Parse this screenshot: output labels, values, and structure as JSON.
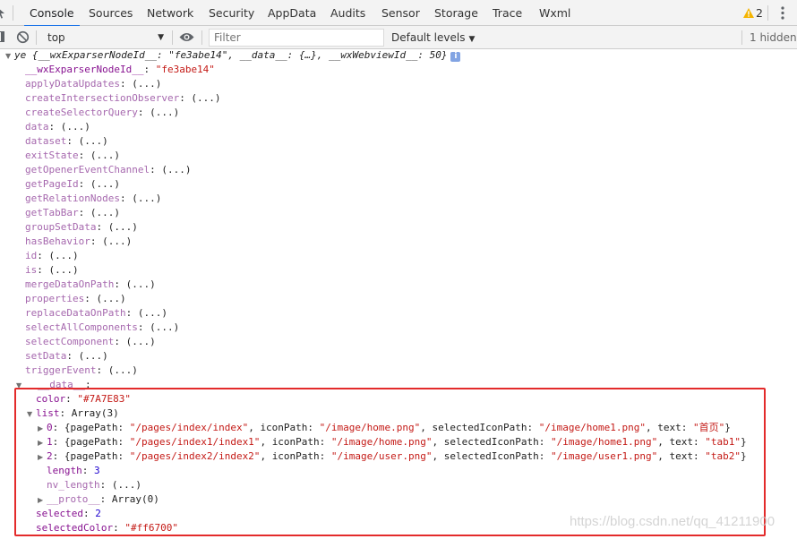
{
  "tabs": [
    {
      "label": "Console",
      "active": true
    },
    {
      "label": "Sources"
    },
    {
      "label": "Network"
    },
    {
      "label": "Security"
    },
    {
      "label": "AppData"
    },
    {
      "label": "Audits"
    },
    {
      "label": "Sensor"
    },
    {
      "label": "Storage"
    },
    {
      "label": "Trace"
    },
    {
      "label": "Wxml"
    }
  ],
  "warnings_count": "2",
  "toolbar": {
    "context": "top",
    "filter_placeholder": "Filter",
    "levels": "Default levels",
    "hidden": "1 hidden"
  },
  "console": {
    "header": {
      "name": "ye",
      "preview": "{__wxExparserNodeId__: \"fe3abe14\", __data__: {…}, __wxWebviewId__: 50}"
    },
    "node_id_key": "__wxExparserNodeId__",
    "node_id_value": "\"fe3abe14\"",
    "methods": [
      "applyDataUpdates",
      "createIntersectionObserver",
      "createSelectorQuery",
      "data",
      "dataset",
      "exitState",
      "getOpenerEventChannel",
      "getPageId",
      "getRelationNodes",
      "getTabBar",
      "groupSetData",
      "hasBehavior",
      "id",
      "is",
      "mergeDataOnPath",
      "properties",
      "replaceDataOnPath",
      "selectAllComponents",
      "selectComponent",
      "setData",
      "triggerEvent"
    ],
    "lazy_value": ": (...)",
    "data_key": "__data__",
    "color_key": "color",
    "color_value": "\"#7A7E83\"",
    "list_key": "list",
    "list_value": "Array(3)",
    "items": [
      {
        "index": "0",
        "pagePath": "\"/pages/index/index\"",
        "iconPath": "\"/image/home.png\"",
        "selectedIconPath": "\"/image/home1.png\"",
        "text": "\"首页\""
      },
      {
        "index": "1",
        "pagePath": "\"/pages/index1/index1\"",
        "iconPath": "\"/image/home.png\"",
        "selectedIconPath": "\"/image/home1.png\"",
        "text": "\"tab1\""
      },
      {
        "index": "2",
        "pagePath": "\"/pages/index2/index2\"",
        "iconPath": "\"/image/user.png\"",
        "selectedIconPath": "\"/image/user1.png\"",
        "text": "\"tab2\""
      }
    ],
    "length_key": "length",
    "length_value": "3",
    "nv_length_key": "nv_length",
    "proto_key": "__proto__",
    "proto_value": "Array(0)",
    "selected_key": "selected",
    "selected_value": "2",
    "selected_color_key": "selectedColor",
    "selected_color_value": "\"#ff6700\""
  },
  "watermark": "https://blog.csdn.net/qq_41211900",
  "colors": {
    "tab_accent": "#1a73e8",
    "property_key": "#881391",
    "string": "#c41a16",
    "number": "#1c00cf",
    "highlight_border": "#e32b2b",
    "warning": "#f4b400"
  }
}
